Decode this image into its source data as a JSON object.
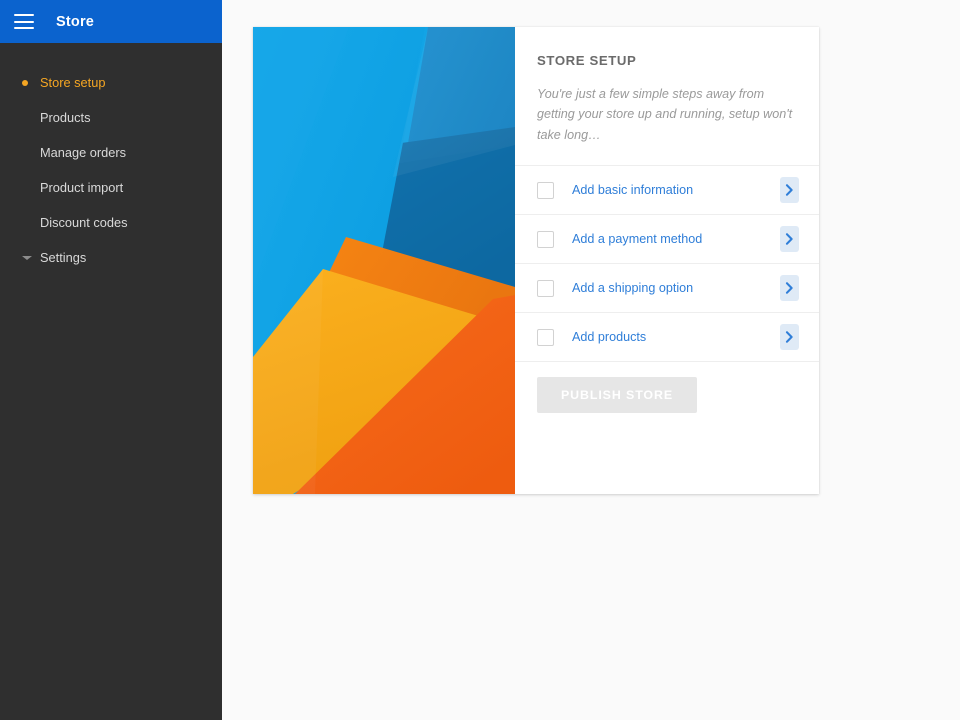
{
  "topbar": {
    "menu_icon": "hamburger-menu-icon",
    "title": "Store",
    "background_color": "#0b63ce"
  },
  "sidebar": {
    "background_color": "#2f2f2f",
    "active_color": "#f5a623",
    "items": [
      {
        "label": "Store setup",
        "active": true,
        "marker": "bullet-dot-icon"
      },
      {
        "label": "Products",
        "active": false,
        "marker": ""
      },
      {
        "label": "Manage orders",
        "active": false,
        "marker": ""
      },
      {
        "label": "Product import",
        "active": false,
        "marker": ""
      },
      {
        "label": "Discount codes",
        "active": false,
        "marker": ""
      },
      {
        "label": "Settings",
        "active": false,
        "marker": "caret-down-icon"
      }
    ]
  },
  "card": {
    "hero": {
      "name": "material-design-abstract-artwork",
      "colors": {
        "light_blue": "#0aa0e4",
        "mid_blue": "#1386c8",
        "dark_blue": "#0f6ea8",
        "deep_blue": "#12639b",
        "amber": "#f6a81c",
        "orange": "#f07c13",
        "deep_orange": "#f4621a"
      }
    },
    "title": "STORE SETUP",
    "subtitle": "You're just a few simple steps away from getting your store up and running, setup won't take long…",
    "steps": [
      {
        "label": "Add basic information",
        "checked": false,
        "chevron": "chevron-right-icon"
      },
      {
        "label": "Add a payment method",
        "checked": false,
        "chevron": "chevron-right-icon"
      },
      {
        "label": "Add a shipping option",
        "checked": false,
        "chevron": "chevron-right-icon"
      },
      {
        "label": "Add products",
        "checked": false,
        "chevron": "chevron-right-icon"
      }
    ],
    "publish_label": "PUBLISH STORE",
    "publish_enabled": false,
    "link_color": "#2f7ed8"
  }
}
